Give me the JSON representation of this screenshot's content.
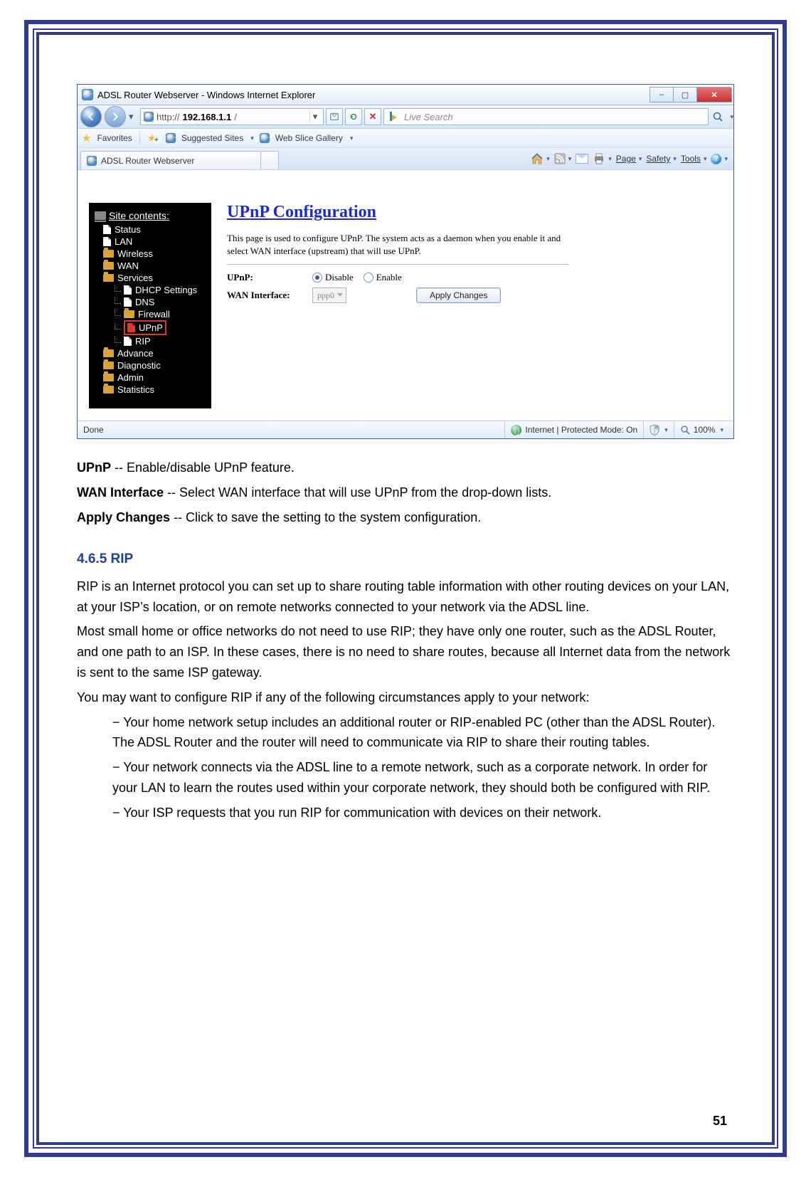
{
  "page_number": "51",
  "browser": {
    "window_title": "ADSL Router Webserver - Windows Internet Explorer",
    "url_prefix": "http://",
    "url_host": "192.168.1.1",
    "url_suffix": "/",
    "search_placeholder": "Live Search",
    "favorites_label": "Favorites",
    "suggested_sites": "Suggested Sites",
    "web_slice": "Web Slice Gallery",
    "tab_title": "ADSL Router Webserver",
    "status_done": "Done",
    "status_zone": "Internet | Protected Mode: On",
    "status_zoom": "100%",
    "cmd": {
      "page": "Page",
      "safety": "Safety",
      "tools": "Tools"
    }
  },
  "tree": {
    "title": "Site contents:",
    "items": [
      "Status",
      "LAN",
      "Wireless",
      "WAN",
      "Services",
      "DHCP Settings",
      "DNS",
      "Firewall",
      "UPnP",
      "RIP",
      "Advance",
      "Diagnostic",
      "Admin",
      "Statistics"
    ]
  },
  "router": {
    "heading": "UPnP Configuration",
    "desc": "This page is used to configure UPnP. The system acts as a daemon when you enable it and select WAN interface (upstream) that will use UPnP.",
    "row1_label": "UPnP:",
    "row2_label": "WAN Interface:",
    "opt_disable": "Disable",
    "opt_enable": "Enable",
    "wan_value": "ppp0",
    "apply": "Apply Changes"
  },
  "defs": [
    {
      "term": "UPnP",
      "text": " -- Enable/disable UPnP feature."
    },
    {
      "term": "WAN Interface",
      "text": " -- Select WAN interface that will use UPnP from the drop-down lists."
    },
    {
      "term": "Apply Changes",
      "text": " -- Click to save the setting to the system configuration."
    }
  ],
  "section_title": "4.6.5 RIP",
  "para1": "RIP is an Internet protocol you can set up to share routing table information with other routing devices on your LAN, at your ISP’s location, or on remote networks connected to your network via the ADSL line.",
  "para2": "Most small home or office networks do not need to use RIP; they have only one router, such as the ADSL Router, and one path to an ISP. In these cases, there is no need to share routes, because all Internet data from the network is sent to the same ISP gateway.",
  "para3": "You may want to configure RIP if any of the following circumstances apply to your network:",
  "bullets": [
    "− Your home network setup includes an additional router or RIP-enabled PC (other than the ADSL Router). The ADSL Router and the router will need to communicate via RIP to share their routing tables.",
    "− Your network connects via the ADSL line to a remote network, such as a corporate network. In order for your LAN to learn the routes used within your corporate network, they should both be configured with RIP.",
    "− Your ISP requests that you run RIP for communication with devices on their network."
  ]
}
